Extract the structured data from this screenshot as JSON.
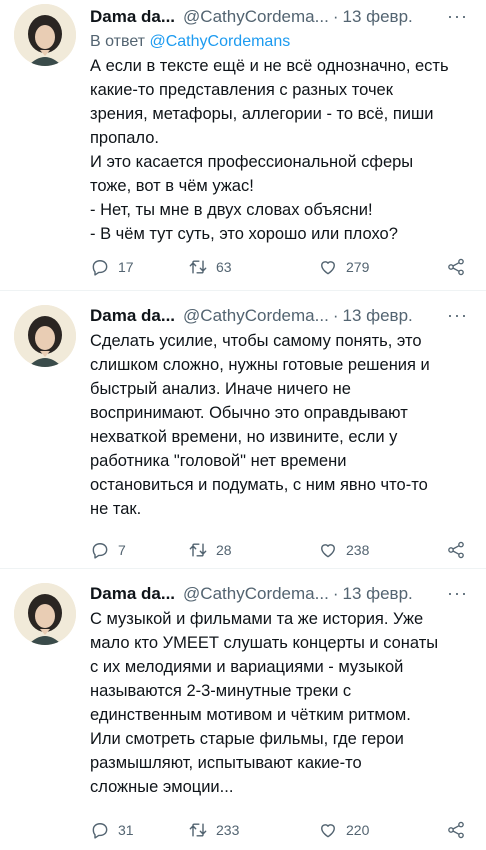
{
  "tweets": [
    {
      "author_name": "Dama da...",
      "handle": "@CathyCordema...",
      "separator": "·",
      "date": "13 февр.",
      "more": "···",
      "reply_prefix": "В ответ",
      "reply_mention": "@CathyCordemans",
      "lines": [
        "А если в тексте ещё и не всё однозначно, есть",
        "какие-то представления с разных точек",
        "зрения, метафоры, аллегории - то всё, пиши",
        "пропало.",
        "И это касается профессиональной сферы",
        "тоже, вот в чём ужас!",
        "- Нет, ты мне в двух словах объясни!",
        "- В чём тут суть, это хорошо или плохо?"
      ],
      "replies": "17",
      "retweets": "63",
      "likes": "279"
    },
    {
      "author_name": "Dama da...",
      "handle": "@CathyCordema...",
      "separator": "·",
      "date": "13 февр.",
      "more": "···",
      "lines": [
        "Сделать усилие, чтобы самому понять, это",
        "слишком сложно, нужны готовые решения и",
        "быстрый анализ. Иначе ничего не",
        "воспринимают. Обычно это оправдывают",
        "нехваткой времени, но извините, если у",
        "работника \"головой\" нет времени",
        "остановиться и подумать, с ним явно что-то",
        "не так."
      ],
      "replies": "7",
      "retweets": "28",
      "likes": "238"
    },
    {
      "author_name": "Dama da...",
      "handle": "@CathyCordema...",
      "separator": "·",
      "date": "13 февр.",
      "more": "···",
      "lines": [
        "С музыкой и фильмами та же история. Уже",
        "мало кто УМЕЕТ слушать концерты и сонаты",
        "с их мелодиями и вариациями - музыкой",
        "называются 2-3-минутные треки с",
        "единственным мотивом и чётким ритмом.",
        "Или смотреть старые фильмы, где герои",
        "размышляют, испытывают какие-то",
        "сложные эмоции..."
      ],
      "replies": "31",
      "retweets": "233",
      "likes": "220"
    }
  ],
  "colors": {
    "text": "#0f1419",
    "secondary": "#536471",
    "link": "#1d9bf0",
    "divider": "#eff3f4"
  },
  "icons": [
    "reply-icon",
    "retweet-icon",
    "like-icon",
    "share-icon",
    "more-icon"
  ]
}
